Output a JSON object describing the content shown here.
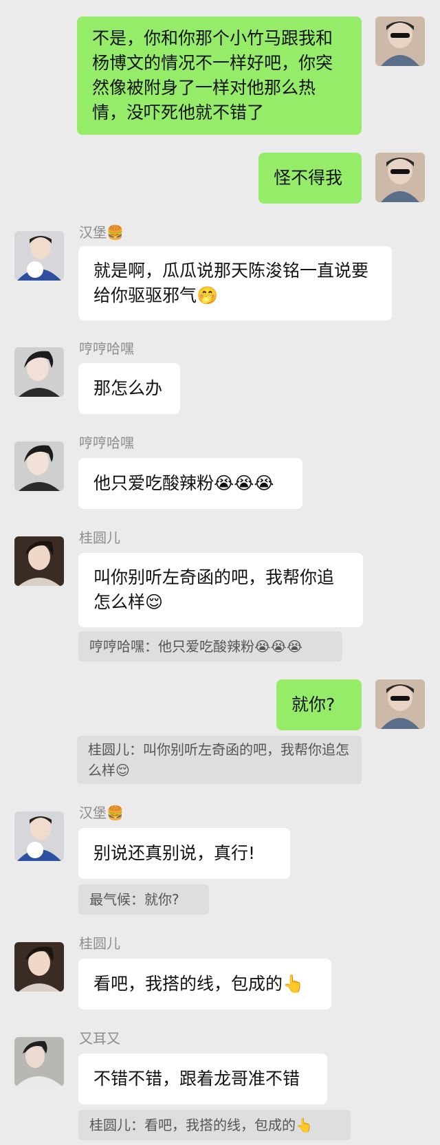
{
  "messages": [
    {
      "id": "m1",
      "side": "out",
      "text": "不是，你和你那个小竹马跟我和杨博文的情况不一样好吧，你突然像被附身了一样对他那么热情，没吓死他就不错了"
    },
    {
      "id": "m2",
      "side": "out",
      "text": "怪不得我"
    },
    {
      "id": "m3",
      "side": "in",
      "sender": "汉堡🍔",
      "text": "就是啊，瓜瓜说那天陈浚铭一直说要给你驱驱邪气🤭"
    },
    {
      "id": "m4",
      "side": "in",
      "sender": "哼哼哈嘿",
      "text": "那怎么办"
    },
    {
      "id": "m5",
      "side": "in",
      "sender": "哼哼哈嘿",
      "text": "他只爱吃酸辣粉😭😭😭"
    },
    {
      "id": "m6",
      "side": "in",
      "sender": "桂圆儿",
      "text": "叫你别听左奇函的吧，我帮你追怎么样😌",
      "quote": "哼哼哈嘿：他只爱吃酸辣粉😭😭😭"
    },
    {
      "id": "m7",
      "side": "out",
      "text": "就你?",
      "quote": "桂圆儿：叫你别听左奇函的吧，我帮你追怎么样😌"
    },
    {
      "id": "m8",
      "side": "in",
      "sender": "汉堡🍔",
      "text": "别说还真别说，真行!",
      "quote": "最气候：就你?"
    },
    {
      "id": "m9",
      "side": "in",
      "sender": "桂圆儿",
      "text": "看吧，我搭的线，包成的👆"
    },
    {
      "id": "m10",
      "side": "in",
      "sender": "又耳又",
      "text": "不错不错，跟着龙哥准不错",
      "quote": "桂圆儿：看吧，我搭的线，包成的👆"
    }
  ],
  "colors": {
    "background": "#ebebeb",
    "outgoing": "#95ec69",
    "incoming": "#ffffff",
    "quote": "#dedede"
  }
}
